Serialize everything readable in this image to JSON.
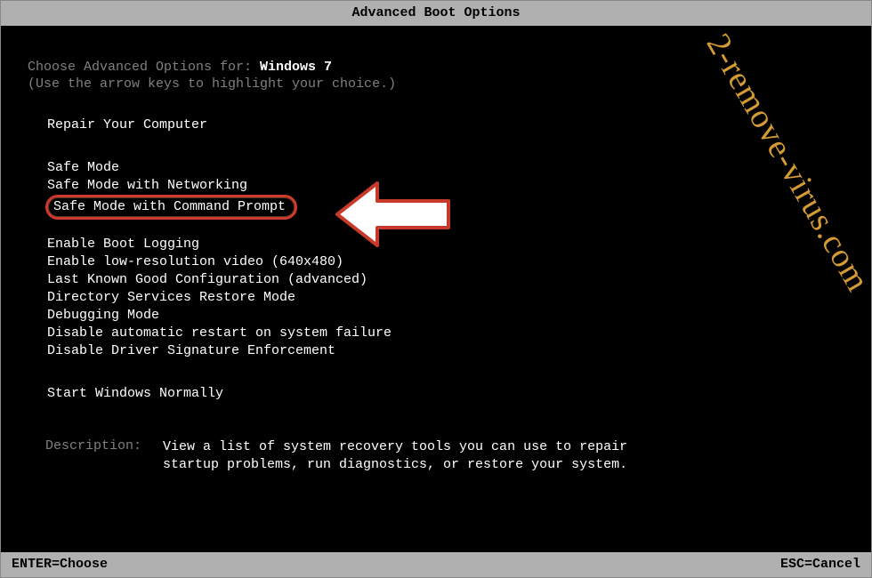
{
  "title": "Advanced Boot Options",
  "choose_label": "Choose Advanced Options for: ",
  "os_name": "Windows 7",
  "hint": "(Use the arrow keys to highlight your choice.)",
  "groups": {
    "repair": {
      "items": [
        "Repair Your Computer"
      ]
    },
    "safe": {
      "items": [
        "Safe Mode",
        "Safe Mode with Networking",
        "Safe Mode with Command Prompt"
      ],
      "highlighted_index": 2
    },
    "advanced": {
      "items": [
        "Enable Boot Logging",
        "Enable low-resolution video (640x480)",
        "Last Known Good Configuration (advanced)",
        "Directory Services Restore Mode",
        "Debugging Mode",
        "Disable automatic restart on system failure",
        "Disable Driver Signature Enforcement"
      ]
    },
    "normal": {
      "items": [
        "Start Windows Normally"
      ]
    }
  },
  "description": {
    "label": "Description:",
    "text": "View a list of system recovery tools you can use to repair startup problems, run diagnostics, or restore your system."
  },
  "footer": {
    "left": "ENTER=Choose",
    "right": "ESC=Cancel"
  },
  "watermark": "2-remove-virus.com",
  "colors": {
    "highlight_border": "#d13a2a",
    "watermark": "#e6a93a",
    "titlebar_bg": "#b0b0b0"
  }
}
